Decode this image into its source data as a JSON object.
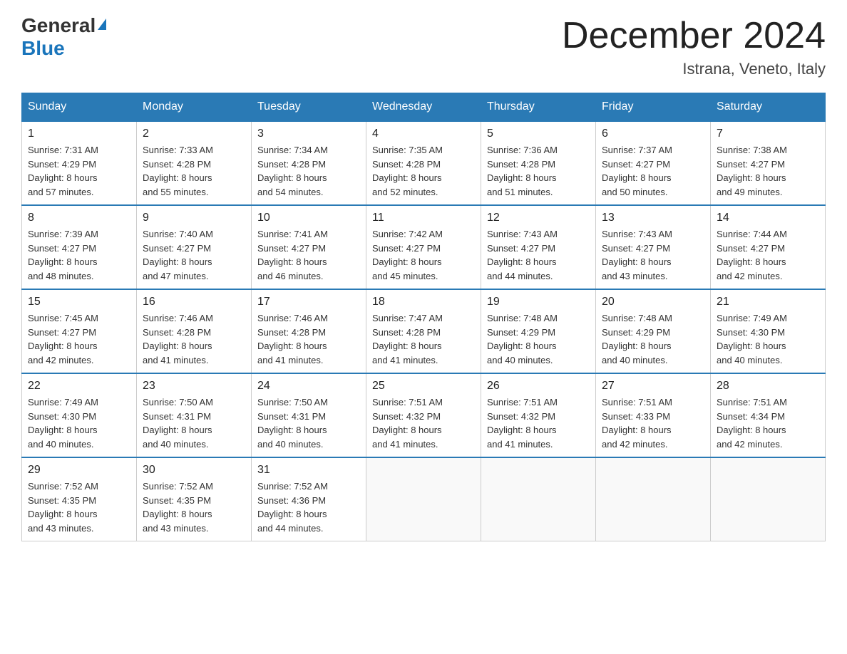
{
  "header": {
    "logo_general": "General",
    "logo_blue": "Blue",
    "month_title": "December 2024",
    "location": "Istrana, Veneto, Italy"
  },
  "days_of_week": [
    "Sunday",
    "Monday",
    "Tuesday",
    "Wednesday",
    "Thursday",
    "Friday",
    "Saturday"
  ],
  "weeks": [
    [
      {
        "day": "1",
        "sunrise": "7:31 AM",
        "sunset": "4:29 PM",
        "daylight": "8 hours and 57 minutes."
      },
      {
        "day": "2",
        "sunrise": "7:33 AM",
        "sunset": "4:28 PM",
        "daylight": "8 hours and 55 minutes."
      },
      {
        "day": "3",
        "sunrise": "7:34 AM",
        "sunset": "4:28 PM",
        "daylight": "8 hours and 54 minutes."
      },
      {
        "day": "4",
        "sunrise": "7:35 AM",
        "sunset": "4:28 PM",
        "daylight": "8 hours and 52 minutes."
      },
      {
        "day": "5",
        "sunrise": "7:36 AM",
        "sunset": "4:28 PM",
        "daylight": "8 hours and 51 minutes."
      },
      {
        "day": "6",
        "sunrise": "7:37 AM",
        "sunset": "4:27 PM",
        "daylight": "8 hours and 50 minutes."
      },
      {
        "day": "7",
        "sunrise": "7:38 AM",
        "sunset": "4:27 PM",
        "daylight": "8 hours and 49 minutes."
      }
    ],
    [
      {
        "day": "8",
        "sunrise": "7:39 AM",
        "sunset": "4:27 PM",
        "daylight": "8 hours and 48 minutes."
      },
      {
        "day": "9",
        "sunrise": "7:40 AM",
        "sunset": "4:27 PM",
        "daylight": "8 hours and 47 minutes."
      },
      {
        "day": "10",
        "sunrise": "7:41 AM",
        "sunset": "4:27 PM",
        "daylight": "8 hours and 46 minutes."
      },
      {
        "day": "11",
        "sunrise": "7:42 AM",
        "sunset": "4:27 PM",
        "daylight": "8 hours and 45 minutes."
      },
      {
        "day": "12",
        "sunrise": "7:43 AM",
        "sunset": "4:27 PM",
        "daylight": "8 hours and 44 minutes."
      },
      {
        "day": "13",
        "sunrise": "7:43 AM",
        "sunset": "4:27 PM",
        "daylight": "8 hours and 43 minutes."
      },
      {
        "day": "14",
        "sunrise": "7:44 AM",
        "sunset": "4:27 PM",
        "daylight": "8 hours and 42 minutes."
      }
    ],
    [
      {
        "day": "15",
        "sunrise": "7:45 AM",
        "sunset": "4:27 PM",
        "daylight": "8 hours and 42 minutes."
      },
      {
        "day": "16",
        "sunrise": "7:46 AM",
        "sunset": "4:28 PM",
        "daylight": "8 hours and 41 minutes."
      },
      {
        "day": "17",
        "sunrise": "7:46 AM",
        "sunset": "4:28 PM",
        "daylight": "8 hours and 41 minutes."
      },
      {
        "day": "18",
        "sunrise": "7:47 AM",
        "sunset": "4:28 PM",
        "daylight": "8 hours and 41 minutes."
      },
      {
        "day": "19",
        "sunrise": "7:48 AM",
        "sunset": "4:29 PM",
        "daylight": "8 hours and 40 minutes."
      },
      {
        "day": "20",
        "sunrise": "7:48 AM",
        "sunset": "4:29 PM",
        "daylight": "8 hours and 40 minutes."
      },
      {
        "day": "21",
        "sunrise": "7:49 AM",
        "sunset": "4:30 PM",
        "daylight": "8 hours and 40 minutes."
      }
    ],
    [
      {
        "day": "22",
        "sunrise": "7:49 AM",
        "sunset": "4:30 PM",
        "daylight": "8 hours and 40 minutes."
      },
      {
        "day": "23",
        "sunrise": "7:50 AM",
        "sunset": "4:31 PM",
        "daylight": "8 hours and 40 minutes."
      },
      {
        "day": "24",
        "sunrise": "7:50 AM",
        "sunset": "4:31 PM",
        "daylight": "8 hours and 40 minutes."
      },
      {
        "day": "25",
        "sunrise": "7:51 AM",
        "sunset": "4:32 PM",
        "daylight": "8 hours and 41 minutes."
      },
      {
        "day": "26",
        "sunrise": "7:51 AM",
        "sunset": "4:32 PM",
        "daylight": "8 hours and 41 minutes."
      },
      {
        "day": "27",
        "sunrise": "7:51 AM",
        "sunset": "4:33 PM",
        "daylight": "8 hours and 42 minutes."
      },
      {
        "day": "28",
        "sunrise": "7:51 AM",
        "sunset": "4:34 PM",
        "daylight": "8 hours and 42 minutes."
      }
    ],
    [
      {
        "day": "29",
        "sunrise": "7:52 AM",
        "sunset": "4:35 PM",
        "daylight": "8 hours and 43 minutes."
      },
      {
        "day": "30",
        "sunrise": "7:52 AM",
        "sunset": "4:35 PM",
        "daylight": "8 hours and 43 minutes."
      },
      {
        "day": "31",
        "sunrise": "7:52 AM",
        "sunset": "4:36 PM",
        "daylight": "8 hours and 44 minutes."
      },
      null,
      null,
      null,
      null
    ]
  ],
  "labels": {
    "sunrise": "Sunrise:",
    "sunset": "Sunset:",
    "daylight": "Daylight:"
  }
}
